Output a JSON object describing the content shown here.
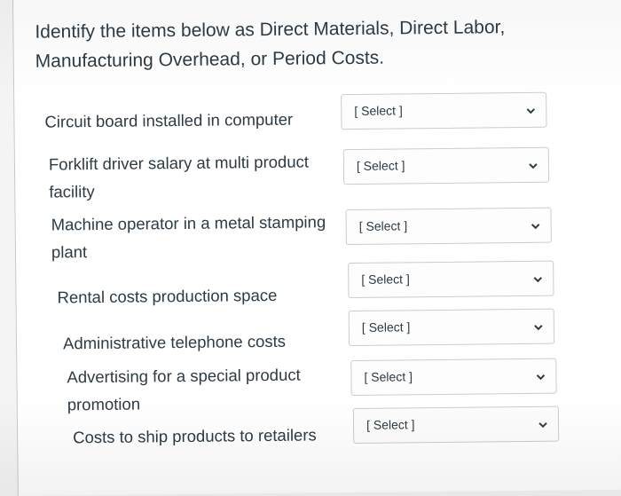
{
  "question": {
    "prompt": "Identify the items below as Direct Materials, Direct Labor, Manufacturing Overhead, or Period Costs."
  },
  "items": [
    {
      "label": "Circuit board installed in computer",
      "select": "[ Select ]"
    },
    {
      "label": "Forklift driver salary at multi product facility",
      "select": "[ Select ]"
    },
    {
      "label": "Machine operator in a metal stamping plant",
      "select": "[ Select ]"
    },
    {
      "label": "Rental costs production space",
      "select": "[ Select ]"
    },
    {
      "label": "Administrative telephone costs",
      "select": "[ Select ]"
    },
    {
      "label": "Advertising for a special product promotion",
      "select": "[ Select ]"
    },
    {
      "label": "Costs to ship products to retailers",
      "select": "[ Select ]"
    }
  ],
  "icons": {
    "dropdown": "chevron-down-icon"
  }
}
